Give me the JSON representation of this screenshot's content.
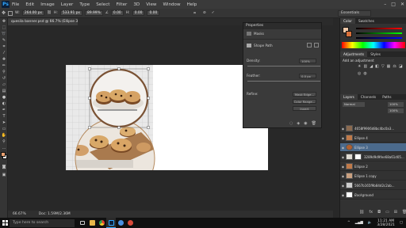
{
  "menubar": {
    "app_logo": "Ps",
    "items": [
      "File",
      "Edit",
      "Image",
      "Layer",
      "Type",
      "Select",
      "Filter",
      "3D",
      "View",
      "Window",
      "Help"
    ],
    "controls": [
      "–",
      "□",
      "✕"
    ]
  },
  "options": {
    "w_label": "W:",
    "w_value": "264.00 px",
    "h_label": "H:",
    "h_value": "533.91 px",
    "zoom_value": "89.99%",
    "angle_value": "0.00",
    "mode_label": "H:",
    "hskew_value": "0.00",
    "vskew_value": "0.00",
    "workspace": "Essentials"
  },
  "document": {
    "tab_label": "quesila banner.psd @ 66.7% (Ellipse 3, RGB/8) *",
    "status_zoom": "66.67%",
    "status_doc": "Doc: 1.59M/2.36M"
  },
  "properties": {
    "title": "Properties",
    "section": "Masks",
    "mask_type": "Shape Path",
    "density_label": "Density:",
    "density_value": "100%",
    "feather_label": "Feather:",
    "feather_value": "0.0 px",
    "refine_label": "Refine:",
    "btn_mask_edge": "Mask Edge...",
    "btn_color_range": "Color Range...",
    "btn_invert": "Invert"
  },
  "right": {
    "color_tab": "Color",
    "swatches_tab": "Swatches",
    "adjust_tab": "Adjustments",
    "styles_tab": "Styles",
    "add_adjustment": "Add an adjustment",
    "layers_tab": "Layers",
    "channels_tab": "Channels",
    "paths_tab": "Paths",
    "blend_mode": "Normal",
    "opacity": "100%",
    "fill": "100%",
    "fg_color": "#f0c8a8",
    "bg_color": "#d8703a"
  },
  "layers": [
    {
      "name": "4658f9906d8bc4bc0a3...",
      "thumb": "#8a6a50"
    },
    {
      "name": "Ellipse 4",
      "thumb": "#c07a4a"
    },
    {
      "name": "Ellipse 3",
      "thumb": "#b06030"
    },
    {
      "name": "3289d9d9fee68a61d05...",
      "thumb": "#e0dcd4"
    },
    {
      "name": "Ellipse 2",
      "thumb": "#c07a4a"
    },
    {
      "name": "Ellipse 1 copy",
      "thumb": "#c9a080"
    },
    {
      "name": "5667b165f9b84d2c2ab...",
      "thumb": "#cccccc"
    },
    {
      "name": "Background",
      "thumb": "#ffffff"
    }
  ],
  "taskbar": {
    "search_placeholder": "Type here to search",
    "time": "11:21 AM",
    "date": "3/28/2021"
  }
}
